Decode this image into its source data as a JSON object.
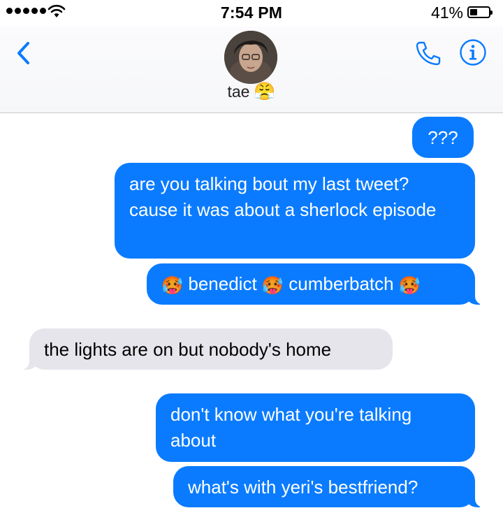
{
  "status_bar": {
    "time": "7:54 PM",
    "battery_percent": "41%",
    "battery_level": 0.41,
    "signal_dots": 5
  },
  "header": {
    "contact_name": "tae",
    "contact_emoji": "😤",
    "back_icon": "chevron-left-icon",
    "call_icon": "phone-icon",
    "info_icon": "info-icon",
    "accent_color": "#0a7bff"
  },
  "messages": [
    {
      "from": "me",
      "text": "???"
    },
    {
      "from": "me",
      "text": "are you talking bout my last tweet? cause it was about a sherlock episode"
    },
    {
      "from": "me",
      "emoji": "🥵",
      "words": [
        "benedict",
        "cumberbatch"
      ]
    },
    {
      "from": "them",
      "text": "the lights are on but nobody's home"
    },
    {
      "from": "me",
      "text": "don't know what you're talking about"
    },
    {
      "from": "me",
      "text": "what's with yeri's bestfriend?"
    }
  ]
}
